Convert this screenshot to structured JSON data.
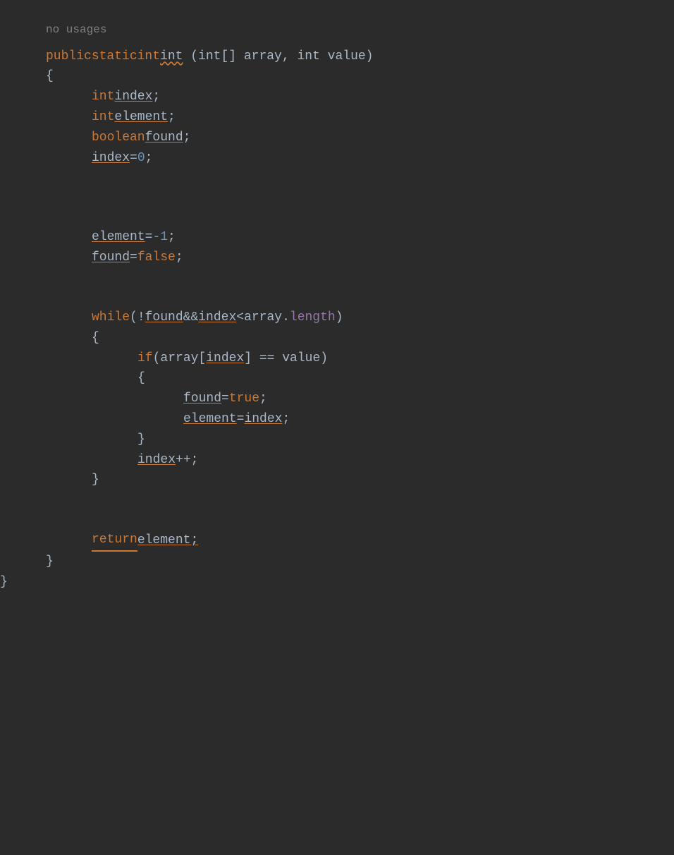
{
  "code": {
    "no_usages": "no usages",
    "signature": {
      "public": "public",
      "static": "static",
      "int": "int",
      "method": "int",
      "params": "(int[] array, int value)"
    },
    "lines": [
      {
        "id": "open-brace-outer",
        "content": "{"
      },
      {
        "id": "int-index",
        "indent": 1,
        "content": "int index;"
      },
      {
        "id": "int-element",
        "indent": 1,
        "content": "int element;"
      },
      {
        "id": "boolean-found",
        "indent": 1,
        "content": "boolean found;"
      },
      {
        "id": "index-assign",
        "indent": 1,
        "content": "index = 0;"
      },
      {
        "id": "empty1",
        "empty": true
      },
      {
        "id": "empty2",
        "empty": true
      },
      {
        "id": "empty3",
        "empty": true
      },
      {
        "id": "element-assign",
        "indent": 1,
        "content": "element = -1;"
      },
      {
        "id": "found-assign-false",
        "indent": 1,
        "content": "found = false;"
      },
      {
        "id": "empty4",
        "empty": true
      },
      {
        "id": "empty5",
        "empty": true
      },
      {
        "id": "while-line",
        "indent": 1,
        "content": "while (!found && index < array.length)"
      },
      {
        "id": "open-brace-while",
        "indent": 1,
        "content": "{"
      },
      {
        "id": "if-line",
        "indent": 2,
        "content": "if (array[index] == value)"
      },
      {
        "id": "open-brace-if",
        "indent": 2,
        "content": "{"
      },
      {
        "id": "found-true",
        "indent": 3,
        "content": "found = true;"
      },
      {
        "id": "element-index",
        "indent": 3,
        "content": "element = index;"
      },
      {
        "id": "close-brace-if",
        "indent": 2,
        "content": "}"
      },
      {
        "id": "index-increment",
        "indent": 2,
        "content": "index++;"
      },
      {
        "id": "close-brace-while",
        "indent": 1,
        "content": "}"
      },
      {
        "id": "empty6",
        "empty": true
      },
      {
        "id": "empty7",
        "empty": true
      },
      {
        "id": "return-line",
        "indent": 1,
        "content": "return element;"
      },
      {
        "id": "close-brace-outer",
        "content": "}"
      },
      {
        "id": "close-brace-end",
        "content": "}"
      }
    ]
  }
}
